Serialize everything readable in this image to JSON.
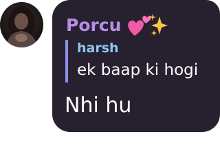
{
  "sender": {
    "avatar_icon": "profile-photo",
    "name": "Porcu",
    "name_color": "#b58ee6",
    "badge_icons": [
      "two-hearts-icon",
      "sparkles-icon"
    ]
  },
  "reply": {
    "author": "harsh",
    "author_color": "#8fc6ef",
    "bar_color": "#8b8fe8",
    "text": "ek baap ki hogi"
  },
  "message": {
    "text": "Nhi hu"
  },
  "colors": {
    "bubble": "#27212f",
    "text": "#ffffff"
  }
}
